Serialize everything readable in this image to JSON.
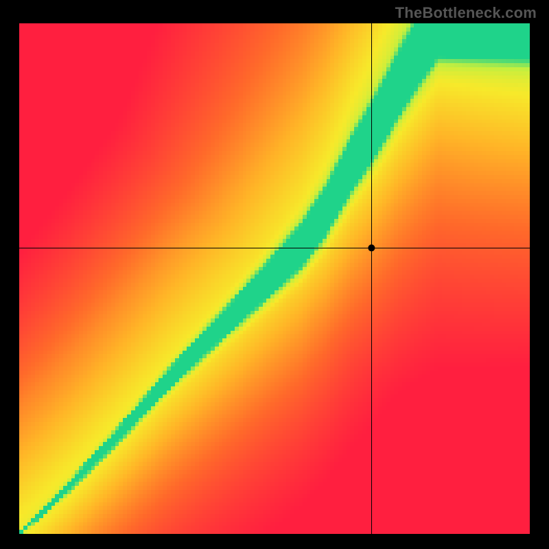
{
  "watermark": "TheBottleneck.com",
  "chart_data": {
    "type": "heatmap",
    "title": "",
    "xlabel": "",
    "ylabel": "",
    "domain_x": [
      0,
      1
    ],
    "domain_y": [
      0,
      1
    ],
    "crosshair": {
      "x": 0.69,
      "y": 0.56
    },
    "marker": {
      "x": 0.69,
      "y": 0.56
    },
    "ridge": {
      "description": "Center of green optimal band as y(x). Piecewise: near-linear from (0,0) to (~0.55,~0.55), then steeper to (~0.82,~1).",
      "points": [
        [
          0.0,
          0.0
        ],
        [
          0.1,
          0.095
        ],
        [
          0.2,
          0.2
        ],
        [
          0.3,
          0.31
        ],
        [
          0.4,
          0.41
        ],
        [
          0.5,
          0.51
        ],
        [
          0.55,
          0.56
        ],
        [
          0.6,
          0.63
        ],
        [
          0.65,
          0.72
        ],
        [
          0.7,
          0.8
        ],
        [
          0.75,
          0.89
        ],
        [
          0.8,
          0.97
        ],
        [
          0.82,
          1.0
        ]
      ]
    },
    "band_halfwidth_y": {
      "description": "Approx half-width of green region along y as function of x.",
      "points": [
        [
          0.0,
          0.004
        ],
        [
          0.1,
          0.01
        ],
        [
          0.25,
          0.018
        ],
        [
          0.4,
          0.028
        ],
        [
          0.55,
          0.045
        ],
        [
          0.7,
          0.055
        ],
        [
          0.82,
          0.06
        ]
      ]
    },
    "colorscale": {
      "description": "Value 0..1 maps red→orange→yellow→green.",
      "stops": [
        [
          0.0,
          "#ff1f3f"
        ],
        [
          0.3,
          "#ff6a2a"
        ],
        [
          0.55,
          "#ffb427"
        ],
        [
          0.75,
          "#f7e92a"
        ],
        [
          0.88,
          "#c4ef3f"
        ],
        [
          1.0,
          "#1fd38a"
        ]
      ]
    },
    "corner_hint": {
      "top_left": 0.0,
      "top_right": 0.6,
      "bottom_left": 0.0,
      "bottom_right": 0.0
    }
  }
}
